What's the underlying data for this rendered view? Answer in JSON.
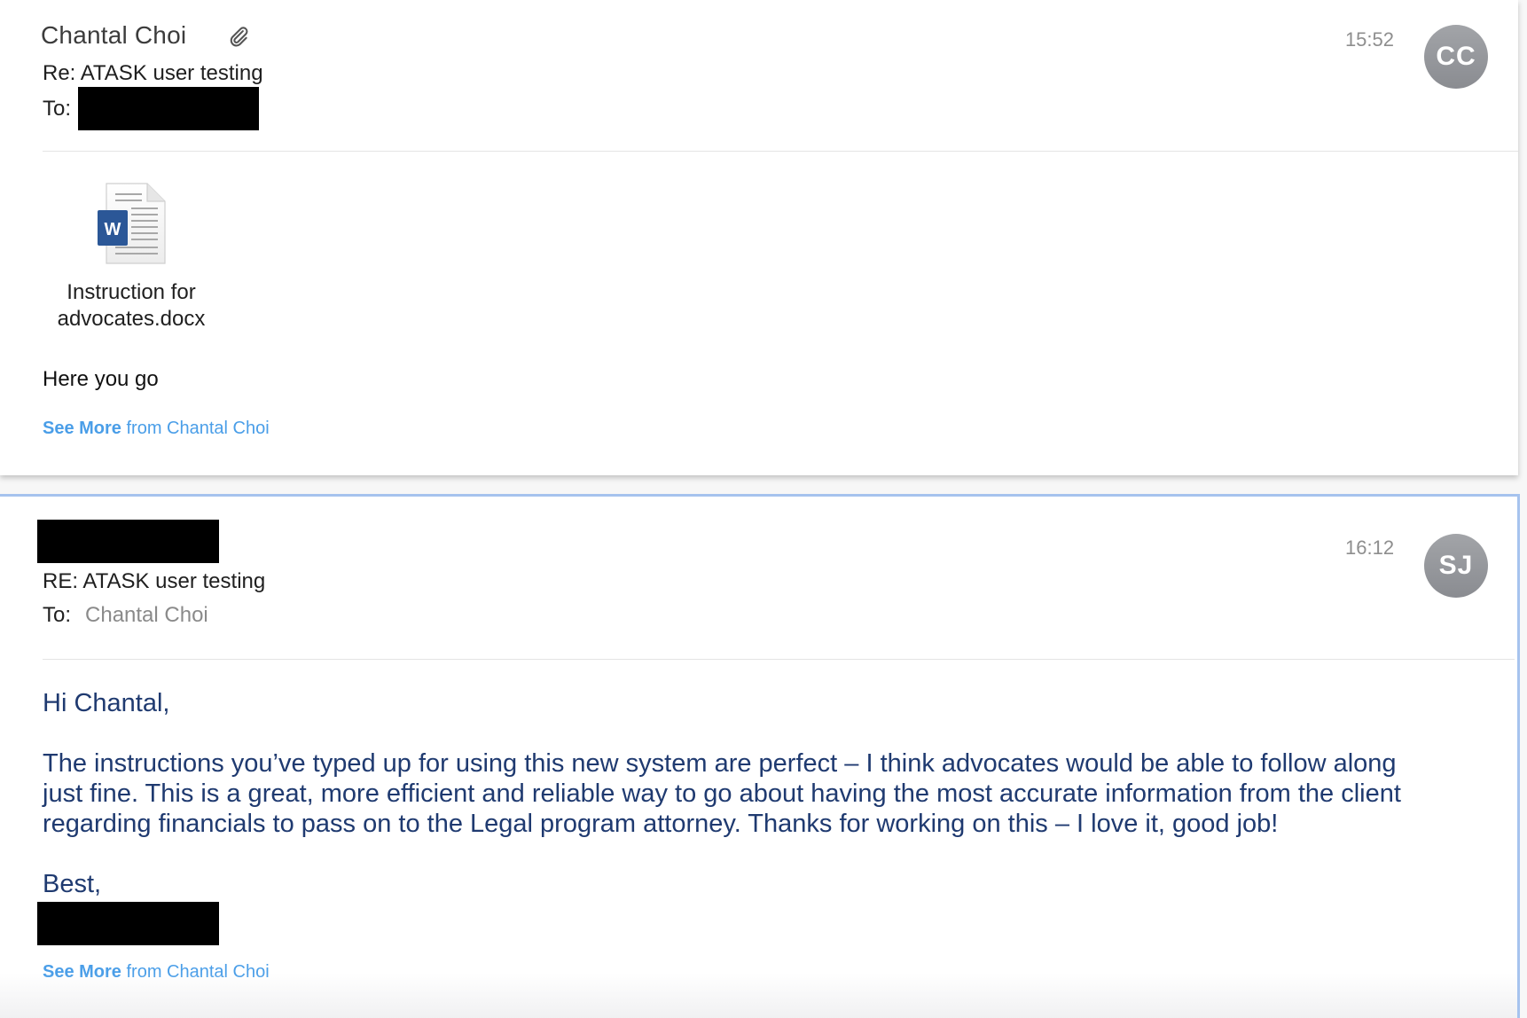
{
  "message1": {
    "sender": "Chantal Choi",
    "subject": "Re: ATASK user testing",
    "to_label": "To:",
    "time": "15:52",
    "avatar_initials": "CC",
    "attachment": {
      "line1": "Instruction for",
      "line2": "advocates.docx",
      "icon": "word-document-icon",
      "badge_letter": "W"
    },
    "body": "Here you go",
    "see_more_bold": "See More",
    "see_more_rest": " from Chantal Choi"
  },
  "message2": {
    "subject": "RE: ATASK user testing",
    "to_label": "To:",
    "to_value": "Chantal Choi",
    "time": "16:12",
    "avatar_initials": "SJ",
    "greeting": "Hi Chantal,",
    "paragraph_lines": [
      "The instructions you’ve typed up for using this new system are perfect – I think advocates would be able to follow along",
      "just fine.  This is a great, more efficient and reliable way to go about having the most accurate information from the client",
      "regarding financials to pass on to the Legal program attorney.  Thanks for working on this – I love it, good job!"
    ],
    "signoff": "Best,",
    "see_more_bold": "See More",
    "see_more_rest": " from Chantal Choi"
  },
  "colors": {
    "link": "#4a9ee8",
    "body_text": "#1f3a70",
    "selection_border": "#a6c3ee",
    "avatar": "#94969b",
    "word_blue": "#2b5797"
  }
}
